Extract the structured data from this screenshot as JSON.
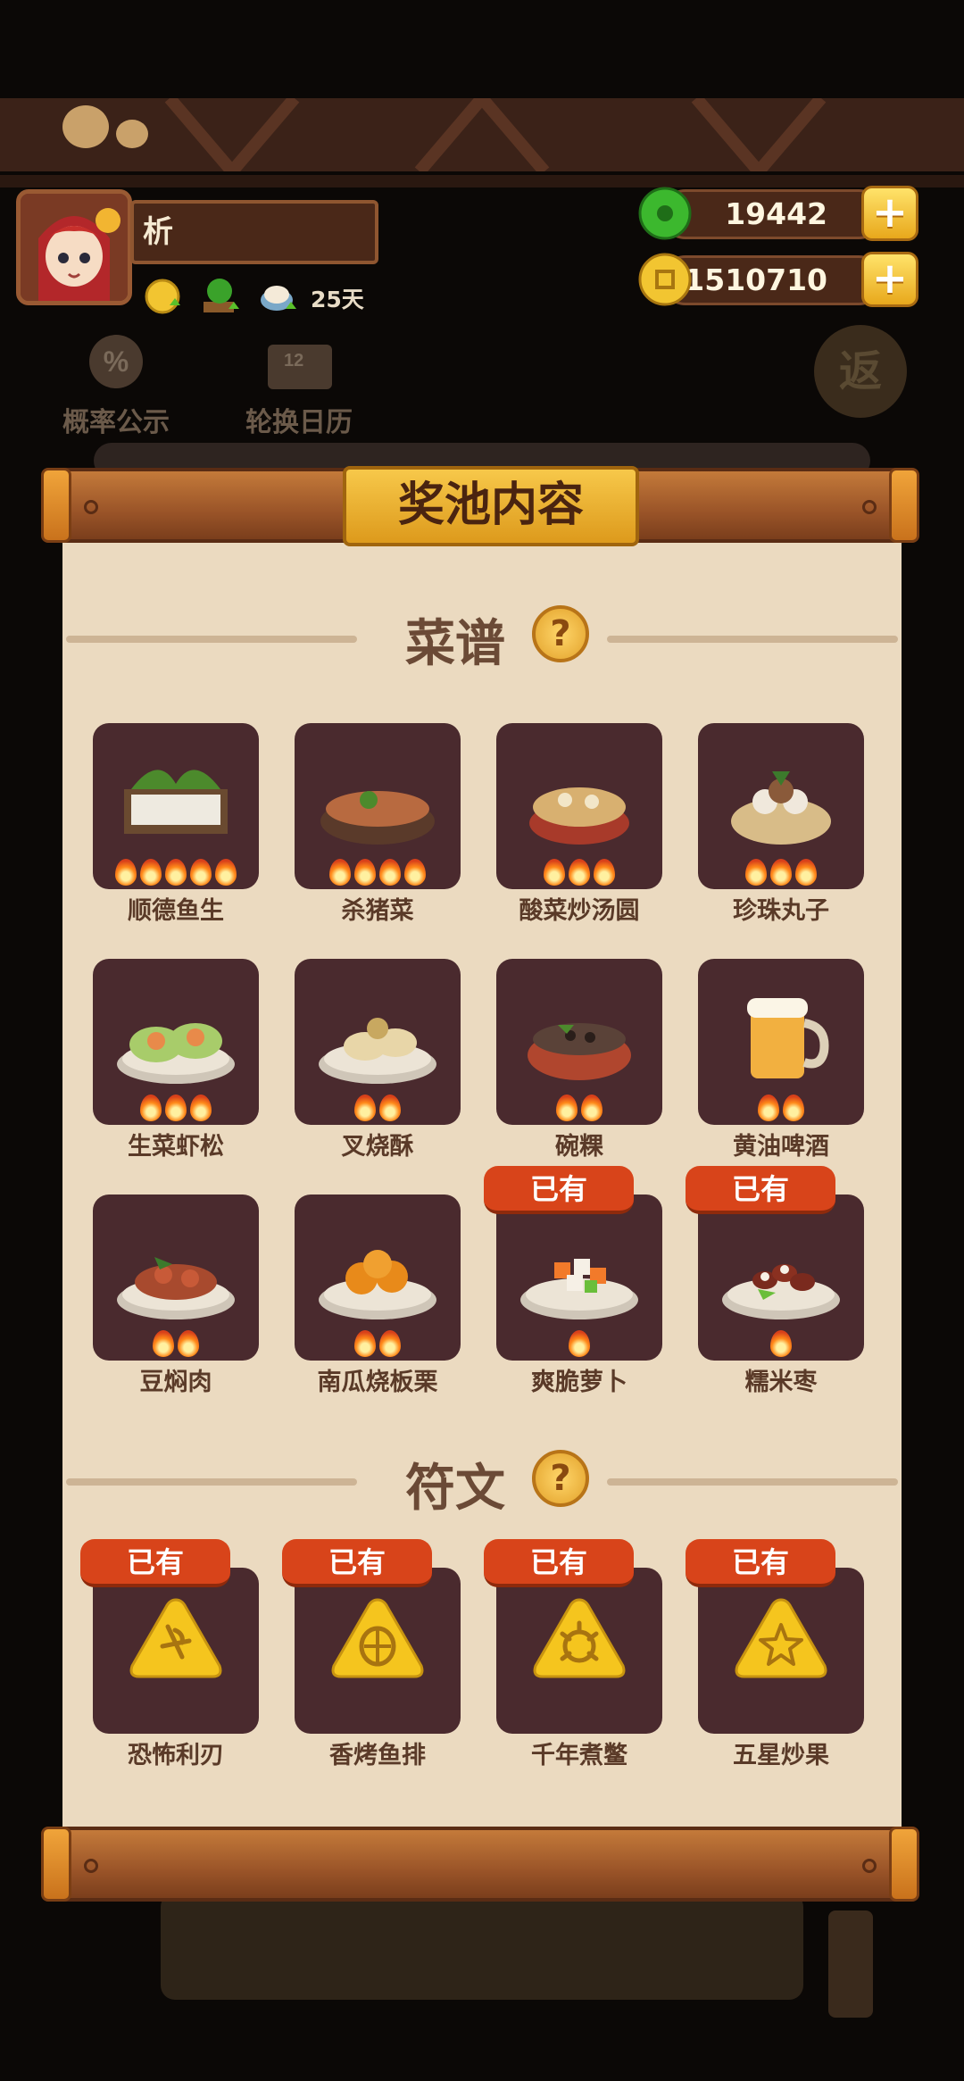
{
  "player": {
    "name": "析",
    "days": "25天"
  },
  "currency": {
    "jade": "19442",
    "coins": "1510710",
    "plus": "+"
  },
  "background": {
    "probability_label": "概率公示",
    "calendar_label": "轮换日历",
    "calendar_number": "12",
    "return_label": "返"
  },
  "dialog": {
    "title": "奖池内容",
    "recipes_section": "菜谱",
    "runes_section": "符文",
    "help": "?",
    "owned_tag": "已有"
  },
  "recipes": [
    {
      "name": "顺德鱼生",
      "flames": 5,
      "owned": false,
      "icon": "fish-dish-icon"
    },
    {
      "name": "杀猪菜",
      "flames": 4,
      "owned": false,
      "icon": "pork-stew-icon"
    },
    {
      "name": "酸菜炒汤圆",
      "flames": 3,
      "owned": false,
      "icon": "dumpling-bowl-icon"
    },
    {
      "name": "珍珠丸子",
      "flames": 3,
      "owned": false,
      "icon": "steamer-balls-icon"
    },
    {
      "name": "生菜虾松",
      "flames": 3,
      "owned": false,
      "icon": "lettuce-shrimp-icon"
    },
    {
      "name": "叉烧酥",
      "flames": 2,
      "owned": false,
      "icon": "pastry-icon"
    },
    {
      "name": "碗粿",
      "flames": 2,
      "owned": false,
      "icon": "bowl-cake-icon"
    },
    {
      "name": "黄油啤酒",
      "flames": 2,
      "owned": false,
      "icon": "beer-mug-icon"
    },
    {
      "name": "豆焖肉",
      "flames": 2,
      "owned": false,
      "icon": "bean-meat-icon"
    },
    {
      "name": "南瓜烧板栗",
      "flames": 2,
      "owned": false,
      "icon": "pumpkin-chestnut-icon"
    },
    {
      "name": "爽脆萝卜",
      "flames": 1,
      "owned": true,
      "icon": "radish-plate-icon"
    },
    {
      "name": "糯米枣",
      "flames": 1,
      "owned": true,
      "icon": "date-plate-icon"
    }
  ],
  "runes": [
    {
      "name": "恐怖利刃",
      "owned": true,
      "icon": "blade-rune-icon"
    },
    {
      "name": "香烤鱼排",
      "owned": true,
      "icon": "fish-rune-icon"
    },
    {
      "name": "千年煮鳖",
      "owned": true,
      "icon": "turtle-rune-icon"
    },
    {
      "name": "五星炒果",
      "owned": true,
      "icon": "star-rune-icon"
    }
  ],
  "colors": {
    "accent": "#d8441a",
    "tile": "#4a2a2e",
    "paper": "#ebdac0",
    "plate": "#f2b531"
  }
}
